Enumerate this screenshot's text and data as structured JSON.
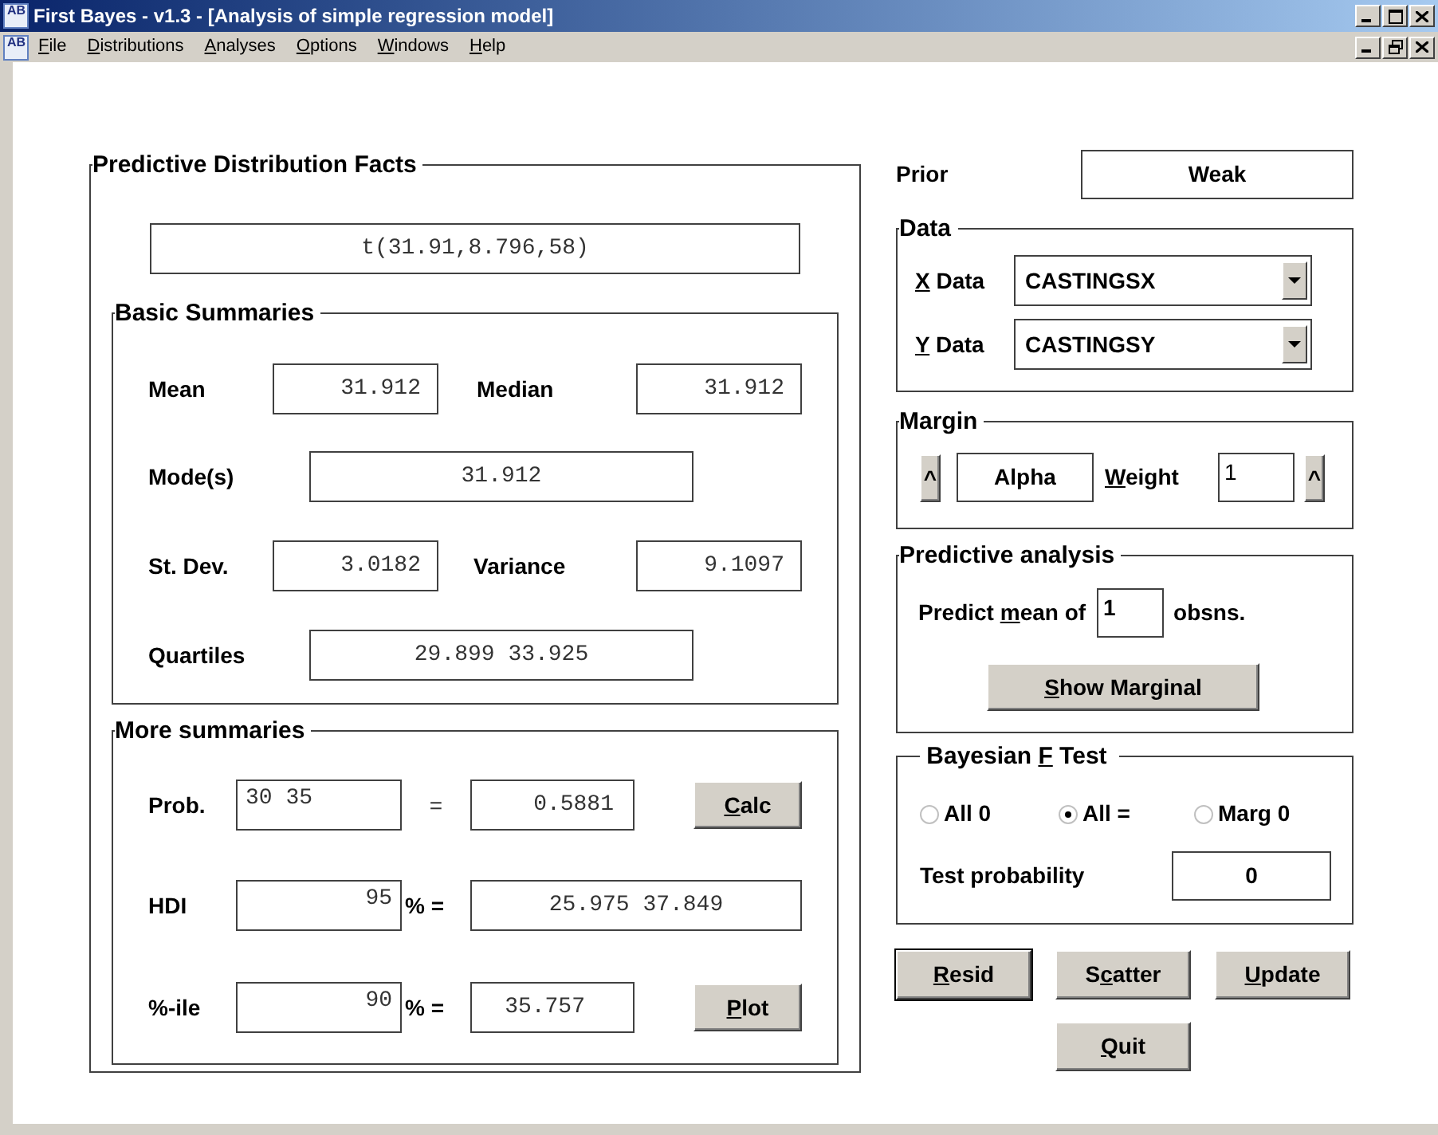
{
  "window": {
    "title": "First Bayes - v1.3 - [Analysis of simple regression model]",
    "icon_text": "AB"
  },
  "menu": {
    "icon_text": "AB",
    "items": [
      {
        "label_parts": {
          "key": "F",
          "after": "ile"
        }
      },
      {
        "label_parts": {
          "key": "D",
          "after": "istributions"
        }
      },
      {
        "label_parts": {
          "key": "A",
          "after": "nalyses"
        }
      },
      {
        "label_parts": {
          "key": "O",
          "after": "ptions"
        }
      },
      {
        "label_parts": {
          "key": "W",
          "after": "indows"
        }
      },
      {
        "label_parts": {
          "key": "H",
          "after": "elp"
        }
      }
    ]
  },
  "facts": {
    "title": "Predictive Distribution Facts",
    "distribution": "t(31.91,8.796,58)",
    "basic": {
      "title": "Basic Summaries",
      "mean_label": "Mean",
      "mean": "31.912",
      "median_label": "Median",
      "median": "31.912",
      "mode_label": "Mode(s)",
      "mode": "31.912",
      "sd_label": "St. Dev.",
      "sd": "3.0182",
      "variance_label": "Variance",
      "variance": "9.1097",
      "quartiles_label": "Quartiles",
      "quartiles": "29.899 33.925"
    },
    "more": {
      "title": "More summaries",
      "prob_label": "Prob.",
      "prob_input": "30 35",
      "prob_equals": "=",
      "prob_result": "0.5881",
      "calc_button": {
        "key": "C",
        "after": "alc"
      },
      "hdi_label": "HDI",
      "hdi_input": "95",
      "hdi_equals": "% =",
      "hdi_result": "25.975 37.849",
      "pct_label": "%-ile",
      "pct_input": "90",
      "pct_equals": "% =",
      "pct_result": "35.757",
      "plot_button": {
        "key": "P",
        "after": "lot"
      }
    }
  },
  "prior": {
    "label": "Prior",
    "value": "Weak"
  },
  "data": {
    "title": "Data",
    "x_label": {
      "key": "X",
      "after": " Data"
    },
    "x_value": "CASTINGSX",
    "y_label": {
      "key": "Y",
      "after": " Data"
    },
    "y_value": "CASTINGSY"
  },
  "margin": {
    "title": "Margin",
    "left_spin": "^",
    "parameter": "Alpha",
    "weight_label": {
      "key": "W",
      "after": "eight"
    },
    "weight": "1",
    "right_spin": "^"
  },
  "predictive": {
    "title": "Predictive analysis",
    "label": {
      "before": "Predict ",
      "key": "m",
      "after": "ean of"
    },
    "count": "1",
    "unit": "obsns.",
    "button": {
      "key": "S",
      "after": "how Marginal"
    }
  },
  "f_test": {
    "title_parts": {
      "before": "Bayesian ",
      "key": "F",
      "after": " Test"
    },
    "options": [
      {
        "label": "All 0",
        "selected": false
      },
      {
        "label": "All =",
        "selected": true
      },
      {
        "label": "Marg 0",
        "selected": false
      }
    ],
    "prob_label": "Test probability",
    "prob": "0"
  },
  "buttons": [
    {
      "label_parts": {
        "key": "R",
        "after": "esid"
      },
      "default": true
    },
    {
      "label_parts": {
        "before": "S",
        "key": "c",
        "after": "atter"
      },
      "default": false
    },
    {
      "label_parts": {
        "key": "U",
        "after": "pdate"
      },
      "default": false
    },
    {
      "label_parts": {
        "key": "Q",
        "after": "uit"
      },
      "default": false
    }
  ]
}
